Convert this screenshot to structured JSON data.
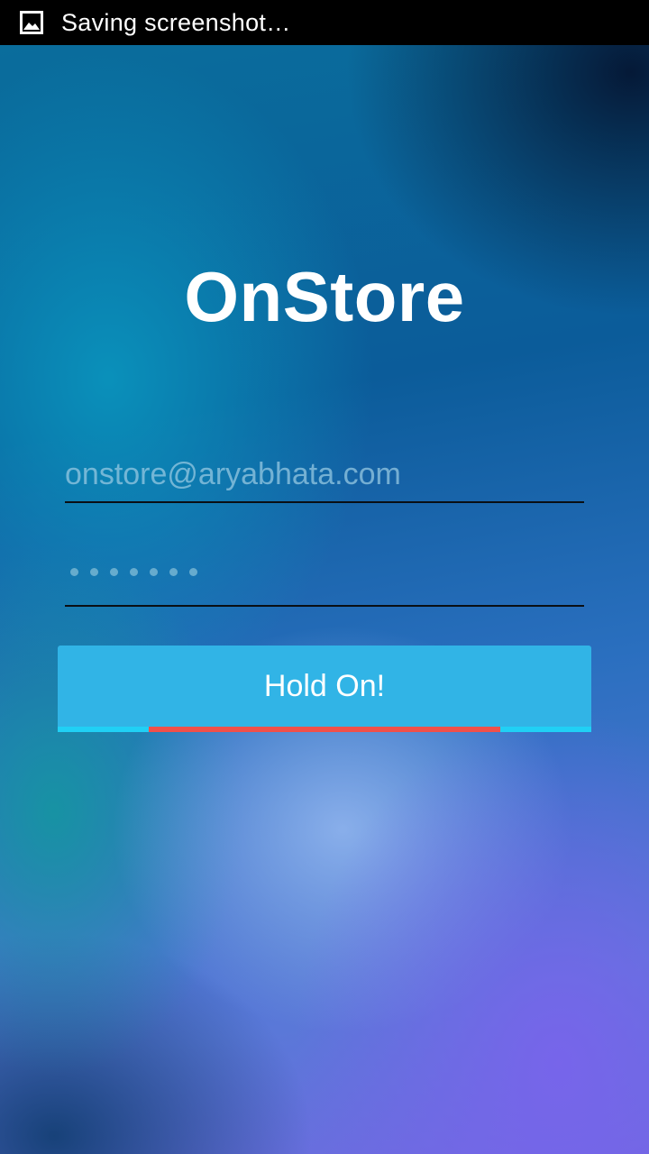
{
  "status_bar": {
    "notification_icon": "image-icon",
    "notification_text": "Saving screenshot…"
  },
  "app": {
    "title": "OnStore"
  },
  "login_form": {
    "email_placeholder": "onstore@aryabhata.com",
    "email_value": "",
    "password_dot_count": 7,
    "submit_label": "Hold On!",
    "progress": {
      "state": "indeterminate",
      "track_color": "#20d0f5",
      "indicator_color": "#f0504a"
    }
  },
  "colors": {
    "button": "#31b4e6",
    "field_underline": "#0a0f14",
    "status_bar": "#000000"
  }
}
